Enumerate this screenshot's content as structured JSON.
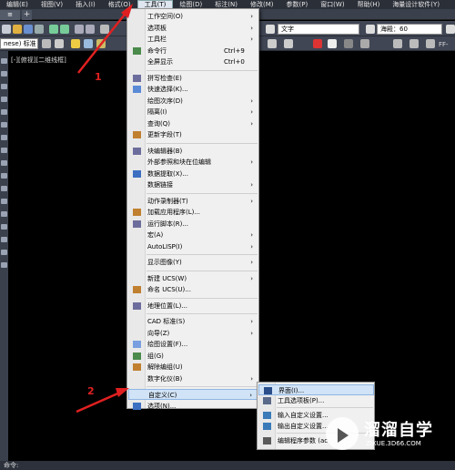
{
  "menubar": {
    "items": [
      "编辑(E)",
      "视图(V)",
      "插入(I)",
      "格式(O)",
      "工具(T)",
      "绘图(D)",
      "标注(N)",
      "修改(M)",
      "参数(P)",
      "窗口(W)",
      "帮助(H)",
      "海量设计软件(Y)"
    ],
    "active_index": 4
  },
  "toolbar": {
    "style_dropdown": "文字",
    "font_dropdown": "海殿：60",
    "layer_dropdown": "nese) 标准"
  },
  "viewport": {
    "label": "[-][俯视][二维线框]",
    "right_tag": "FF-"
  },
  "command_line": {
    "text": "命令:"
  },
  "tools_menu": {
    "items": [
      {
        "label": "工作空间(O)",
        "arrow": "›"
      },
      {
        "label": "选项板",
        "arrow": "›"
      },
      {
        "label": "工具栏",
        "arrow": "›"
      },
      {
        "label": "命令行",
        "shortcut": "Ctrl+9",
        "icon": "command-line-icon"
      },
      {
        "label": "全屏显示",
        "shortcut": "Ctrl+0"
      },
      {
        "label": "拼写检查(E)",
        "icon": "spell-check-icon"
      },
      {
        "label": "快速选择(K)...",
        "icon": "quick-select-icon"
      },
      {
        "label": "绘图次序(D)",
        "arrow": "›"
      },
      {
        "label": "隔离(I)",
        "arrow": "›"
      },
      {
        "label": "查询(Q)",
        "arrow": "›"
      },
      {
        "label": "更新字段(T)",
        "icon": "update-field-icon"
      },
      {
        "label": "块编辑器(B)",
        "icon": "block-editor-icon"
      },
      {
        "label": "外部参照和块在位编辑",
        "arrow": "›"
      },
      {
        "label": "数据提取(X)...",
        "icon": "data-extract-icon"
      },
      {
        "label": "数据链接",
        "arrow": "›"
      },
      {
        "label": "动作录制器(T)",
        "arrow": "›"
      },
      {
        "label": "加载应用程序(L)...",
        "icon": "load-app-icon"
      },
      {
        "label": "运行脚本(R)...",
        "icon": "run-script-icon"
      },
      {
        "label": "宏(A)",
        "arrow": "›"
      },
      {
        "label": "AutoLISP(I)",
        "arrow": "›"
      },
      {
        "label": "显示图像(Y)",
        "arrow": "›"
      },
      {
        "label": "新建 UCS(W)",
        "arrow": "›"
      },
      {
        "label": "命名 UCS(U)...",
        "icon": "named-ucs-icon"
      },
      {
        "label": "地理位置(L)...",
        "icon": "geo-location-icon"
      },
      {
        "label": "CAD 标准(S)",
        "arrow": "›"
      },
      {
        "label": "向导(Z)",
        "arrow": "›"
      },
      {
        "label": "绘图设置(F)...",
        "icon": "drafting-settings-icon"
      },
      {
        "label": "组(G)",
        "icon": "group-icon"
      },
      {
        "label": "解除编组(U)",
        "icon": "ungroup-icon"
      },
      {
        "label": "数字化仪(B)",
        "arrow": "›"
      },
      {
        "label": "自定义(C)",
        "arrow": "›"
      },
      {
        "label": "选项(N)...",
        "icon": "options-icon"
      }
    ]
  },
  "customize_submenu": {
    "items": [
      {
        "label": "界面(I)...",
        "icon": "interface-icon"
      },
      {
        "label": "工具选项板(P)...",
        "icon": "tool-palette-icon"
      },
      {
        "label": "输入自定义设置...",
        "icon": "import-icon"
      },
      {
        "label": "输出自定义设置...",
        "icon": "export-icon"
      },
      {
        "label": "编辑程序参数 (ac",
        "icon": "edit-params-icon"
      }
    ]
  },
  "callouts": {
    "one": "1",
    "two": "2"
  },
  "watermark": {
    "brand": "溜溜自学",
    "url": "ZIXUE.3D66.COM"
  },
  "colors": {
    "highlight": "#d1e3f6",
    "arrow_red": "#e02020",
    "menu_bg": "#f0f0f0"
  }
}
